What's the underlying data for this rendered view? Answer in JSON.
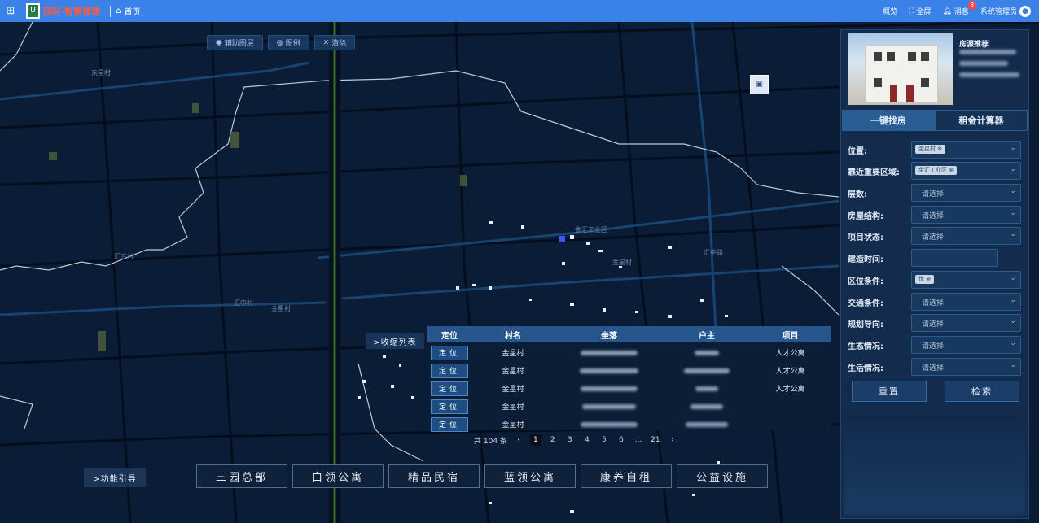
{
  "topbar": {
    "grid_icon": "grid-icon",
    "logo_text": "园区·智慧管理",
    "home": "首页",
    "right": {
      "overview": "概览",
      "fullscreen": "全屏",
      "messages": "消息",
      "messages_count": "8",
      "user": "系统管理员"
    }
  },
  "map_tools": {
    "layers": "辅助图层",
    "legend": "图例",
    "clear": "清除"
  },
  "map_labels": {
    "l1": "东星村",
    "l2": "金星村",
    "l3": "金汇工业区",
    "l4": "汇中路",
    "l5": "金星村",
    "l6": "汇三村",
    "l7": "汇中村"
  },
  "promo": {
    "title": "房源推荐"
  },
  "tabs": {
    "find": "一键找房",
    "rent": "租金计算器"
  },
  "form": {
    "location": {
      "label": "位置:",
      "tag": "金星村 ⊗"
    },
    "nearby": {
      "label": "靠近重要区域:",
      "tag": "金汇工业区 ⊗"
    },
    "floors": {
      "label": "层数:",
      "placeholder": "请选择"
    },
    "structure": {
      "label": "房屋结构:",
      "placeholder": "请选择"
    },
    "status": {
      "label": "项目状态:",
      "placeholder": "请选择"
    },
    "built": {
      "label": "建造时间:"
    },
    "location_cond": {
      "label": "区位条件:",
      "tag": "优 ⊗"
    },
    "traffic": {
      "label": "交通条件:",
      "placeholder": "请选择"
    },
    "planning": {
      "label": "规划导向:",
      "placeholder": "请选择"
    },
    "ecology": {
      "label": "生态情况:",
      "placeholder": "请选择"
    },
    "living": {
      "label": "生活情况:",
      "placeholder": "请选择"
    },
    "reset": "重置",
    "search": "检索"
  },
  "list": {
    "collapse": ">收缩列表",
    "headers": {
      "locate": "定位",
      "village": "村名",
      "address": "坐落",
      "owner": "户主",
      "project": "项目"
    },
    "rows": [
      {
        "locate": "定位",
        "village": "金星村",
        "project": "人才公寓"
      },
      {
        "locate": "定位",
        "village": "金星村",
        "project": "人才公寓"
      },
      {
        "locate": "定位",
        "village": "金星村",
        "project": "人才公寓"
      },
      {
        "locate": "定位",
        "village": "金星村",
        "project": ""
      },
      {
        "locate": "定位",
        "village": "金星村",
        "project": ""
      }
    ],
    "pager": {
      "total": "共 104 条",
      "pages": [
        "1",
        "2",
        "3",
        "4",
        "5",
        "6",
        "...",
        "21"
      ],
      "current": "1"
    }
  },
  "guide": ">功能引导",
  "categories": [
    "三园总部",
    "白领公寓",
    "精品民宿",
    "蓝领公寓",
    "康养自租",
    "公益设施"
  ],
  "colors": {
    "topbar": "#3b82e8",
    "map_bg": "#0b1c36",
    "panel": "#142c4e",
    "accent": "#26568c"
  }
}
